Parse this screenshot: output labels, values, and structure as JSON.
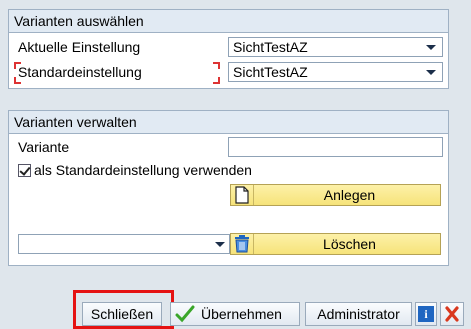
{
  "select_group": {
    "title": "Varianten auswählen",
    "current_label": "Aktuelle Einstellung",
    "current_value": "SichtTestAZ",
    "default_label": "Standardeinstellung",
    "default_value": "SichtTestAZ"
  },
  "manage_group": {
    "title": "Varianten verwalten",
    "variant_label": "Variante",
    "variant_value": "",
    "use_default_label": "als Standardeinstellung verwenden",
    "use_default_checked": true,
    "create_label": "Anlegen",
    "delete_label": "Löschen",
    "delete_select_value": ""
  },
  "toolbar": {
    "close_label": "Schließen",
    "apply_label": "Übernehmen",
    "admin_label": "Administrator"
  },
  "colors": {
    "accent_yellow": "#f6e37a",
    "highlight_red": "#e51212",
    "check_green": "#3aa62a",
    "info_blue": "#1f66c1"
  }
}
